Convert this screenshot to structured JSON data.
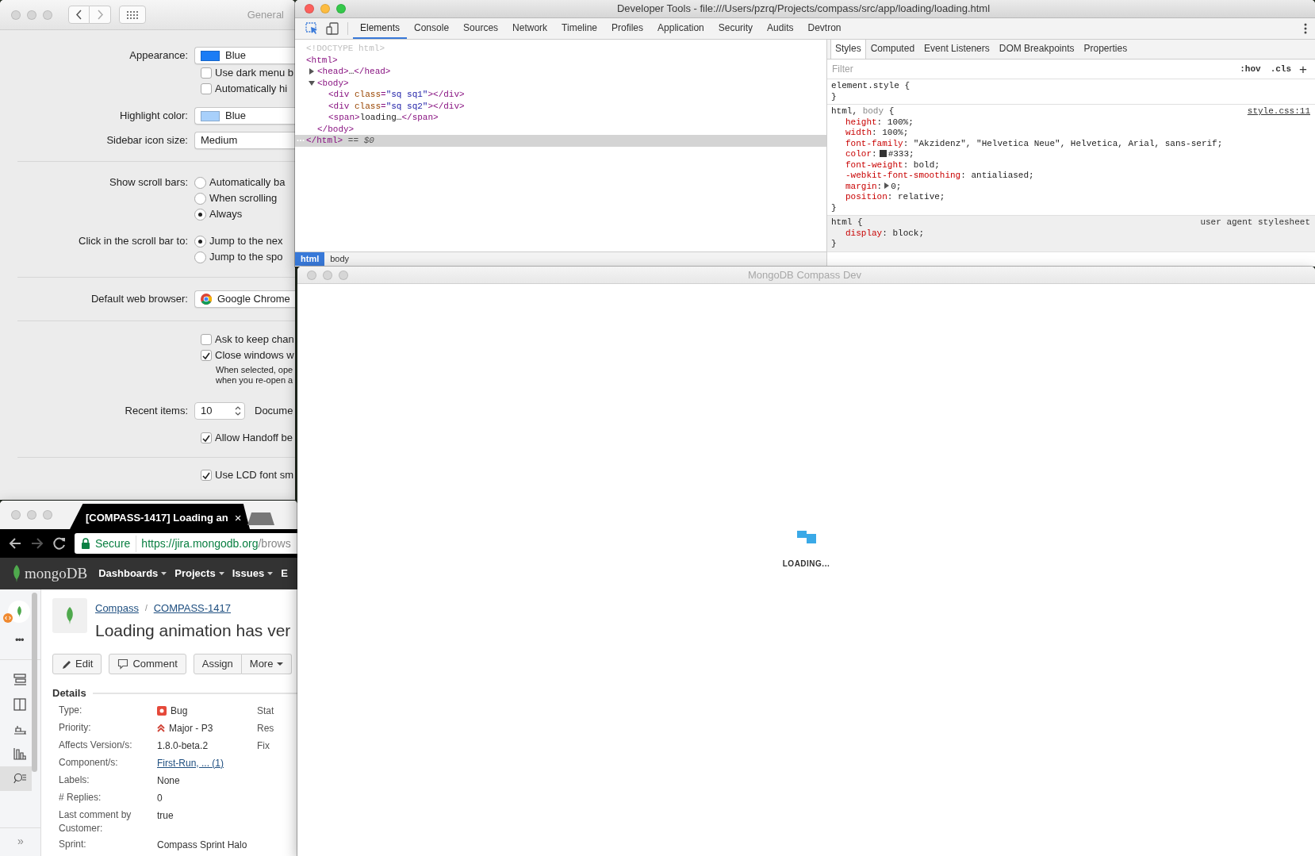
{
  "system_preferences": {
    "title": "General",
    "active": false,
    "sections": [
      {
        "rows": [
          {
            "kind": "popup",
            "label": "Appearance:",
            "value": "Blue",
            "color": "#1b7cf5"
          },
          {
            "kind": "checkbox",
            "text": "Use dark menu b",
            "checked": false
          },
          {
            "kind": "checkbox",
            "text": "Automatically hi",
            "checked": false
          },
          {
            "kind": "popup",
            "label": "Highlight color:",
            "value": "Blue",
            "color": "#a8d0fb"
          },
          {
            "kind": "popup",
            "label": "Sidebar icon size:",
            "value": "Medium"
          }
        ]
      },
      {
        "rows": [
          {
            "kind": "radio",
            "label": "Show scroll bars:",
            "options": [
              {
                "text": "Automatically ba",
                "selected": false
              },
              {
                "text": "When scrolling",
                "selected": false
              },
              {
                "text": "Always",
                "selected": true
              }
            ]
          },
          {
            "kind": "radio",
            "label": "Click in the scroll bar to:",
            "options": [
              {
                "text": "Jump to the nex",
                "selected": true
              },
              {
                "text": "Jump to the spo",
                "selected": false
              }
            ]
          }
        ]
      },
      {
        "rows": [
          {
            "kind": "browser",
            "label": "Default web browser:",
            "value": "Google Chrome"
          }
        ]
      },
      {
        "rows": [
          {
            "kind": "checkbox",
            "text": "Ask to keep chan",
            "checked": false
          },
          {
            "kind": "checkbox",
            "text": "Close windows w",
            "checked": true
          },
          {
            "kind": "note",
            "lines": [
              "When selected, ope",
              "when you re-open a"
            ]
          },
          {
            "kind": "stepper",
            "label": "Recent items:",
            "value": "10",
            "suffix": "Docume"
          },
          {
            "kind": "checkbox",
            "text": "Allow Handoff be",
            "checked": true
          }
        ]
      },
      {
        "rows": [
          {
            "kind": "checkbox",
            "text": "Use LCD font sm",
            "checked": true
          }
        ]
      }
    ]
  },
  "browser": {
    "active": false,
    "tab": {
      "title": "[COMPASS-1417] Loading an",
      "close": "×"
    },
    "address": {
      "secure": "Secure",
      "scheme": "https://",
      "host": "jira.mongodb.org",
      "path": "/brows"
    },
    "site": {
      "logo": "mongoDB",
      "menus": [
        "Dashboards",
        "Projects",
        "Issues",
        "E"
      ],
      "sidebar_items": [
        {
          "selected": false
        },
        {
          "selected": false
        },
        {
          "selected": false
        },
        {
          "selected": false
        },
        {
          "selected": true
        }
      ],
      "more": "•••",
      "expand": "»",
      "breadcrumbs": [
        "Compass",
        "COMPASS-1417"
      ],
      "separator": "/",
      "title": "Loading animation has ver",
      "buttons": [
        {
          "kind": "edit",
          "text": "Edit"
        },
        {
          "kind": "comment",
          "text": "Comment"
        },
        {
          "kind": "plain",
          "text": "Assign"
        },
        {
          "kind": "dropdown",
          "text": "More"
        }
      ],
      "details": {
        "heading": "Details",
        "fields": [
          {
            "label": "Type:",
            "value": "Bug",
            "kind": "bug",
            "column_3": "Stat"
          },
          {
            "label": "Priority:",
            "value": "Major - P3",
            "kind": "priority",
            "column_3": "Res"
          },
          {
            "label": "Affects Version/s:",
            "value": "1.8.0-beta.2",
            "kind": "plain",
            "column_3": "Fix"
          },
          {
            "label": "Component/s:",
            "value": "First-Run, ... (1)",
            "kind": "link"
          },
          {
            "label": "Labels:",
            "value": "None",
            "kind": "plain"
          },
          {
            "label": "# Replies:",
            "value": "0",
            "kind": "plain"
          },
          {
            "label": "Last comment by Customer:",
            "value": "true",
            "kind": "plain"
          },
          {
            "label": "Sprint:",
            "value": "Compass Sprint Halo",
            "kind": "plain"
          }
        ]
      }
    }
  },
  "developer_tools": {
    "active": true,
    "title": "Developer Tools - file:///Users/pzrq/Projects/compass/src/app/loading/loading.html",
    "tabs": [
      {
        "label": "Elements",
        "selected": true
      },
      {
        "label": "Console",
        "selected": false
      },
      {
        "label": "Sources",
        "selected": false
      },
      {
        "label": "Network",
        "selected": false
      },
      {
        "label": "Timeline",
        "selected": false
      },
      {
        "label": "Profiles",
        "selected": false
      },
      {
        "label": "Application",
        "selected": false
      },
      {
        "label": "Security",
        "selected": false
      },
      {
        "label": "Audits",
        "selected": false
      },
      {
        "label": "Devtron",
        "selected": false
      }
    ],
    "dom_tree": [
      {
        "text": "<!DOCTYPE html>",
        "kind": "doctype",
        "selected": false
      },
      {
        "text": "<html>",
        "kind": "tag",
        "selected": false,
        "children": [
          {
            "text": "<head>…</head>",
            "kind": "tag",
            "selected": false,
            "expanded": false
          },
          {
            "text": "<body>",
            "kind": "tag",
            "selected": false,
            "expanded": true,
            "children": [
              {
                "text": "<div class=\"sq sq1\"></div>",
                "kind": "tag",
                "selected": false
              },
              {
                "text": "<div class=\"sq sq2\"></div>",
                "kind": "tag",
                "selected": false
              },
              {
                "text": "<span>loading…</span>",
                "kind": "tag",
                "selected": false
              }
            ]
          },
          {
            "text": "</body>",
            "kind": "tag",
            "selected": false
          }
        ]
      },
      {
        "text": "</html>",
        "kind": "tag",
        "selected": true,
        "suffix": "== $0"
      }
    ],
    "breadcrumbs": [
      {
        "label": "html",
        "selected": true
      },
      {
        "label": "body",
        "selected": false
      }
    ],
    "styles": {
      "tabs": [
        {
          "label": "Styles",
          "selected": true
        },
        {
          "label": "Computed",
          "selected": false
        },
        {
          "label": "Event Listeners",
          "selected": false
        },
        {
          "label": "DOM Breakpoints",
          "selected": false
        },
        {
          "label": "Properties",
          "selected": false
        }
      ],
      "filter": {
        "placeholder": "Filter"
      },
      "toggles": [
        ":hov",
        ".cls"
      ],
      "add": "+",
      "rules": [
        {
          "kind": "inline",
          "selector": [
            {
              "text": "element.style",
              "matched": true
            }
          ],
          "open": "{",
          "close": "}"
        },
        {
          "kind": "author",
          "selector": [
            {
              "text": "html,",
              "matched": true
            },
            {
              "text": "body",
              "matched": false
            }
          ],
          "source": "style.css:11",
          "open": "{",
          "close": "}",
          "properties": [
            {
              "text": "height: 100%;"
            },
            {
              "text": "width: 100%;"
            },
            {
              "text": "font-family: \"Akzidenz\", \"Helvetica Neue\", Helvetica, Arial, sans-serif;"
            },
            {
              "text": "color: #333;",
              "color": "#333333"
            },
            {
              "text": "font-weight: bold;"
            },
            {
              "text": "-webkit-font-smoothing: antialiased;"
            },
            {
              "text": "margin: 0;",
              "expandable": true
            },
            {
              "text": "position: relative;"
            }
          ]
        },
        {
          "kind": "user_agent",
          "selector": [
            {
              "text": "html",
              "matched": true
            }
          ],
          "source": "user agent stylesheet",
          "open": "{",
          "close": "}",
          "properties": [
            {
              "text": "display: block;"
            }
          ]
        }
      ]
    }
  },
  "compass": {
    "active": false,
    "title": "MongoDB Compass Dev",
    "loading": "LOADING..."
  }
}
